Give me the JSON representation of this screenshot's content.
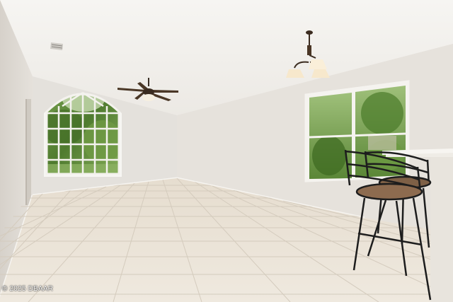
{
  "watermark": {
    "text": "© 2025 DBAAR"
  },
  "colors": {
    "ceiling": "#f3f1ee",
    "wall_back": "#e6e3de",
    "wall_right": "#e4e0da",
    "wall_left": "#dedad4",
    "floor": "#ece5d9",
    "grout": "#d2c8b8",
    "foliage": "#5f8a3a",
    "chair_frame": "#1e1e1e",
    "chair_seat": "#8a6a4e",
    "counter": "#efece6"
  },
  "icons": {
    "ceiling_fan": "ceiling-fan-icon",
    "chandelier": "chandelier-icon",
    "vent": "air-vent-icon"
  }
}
